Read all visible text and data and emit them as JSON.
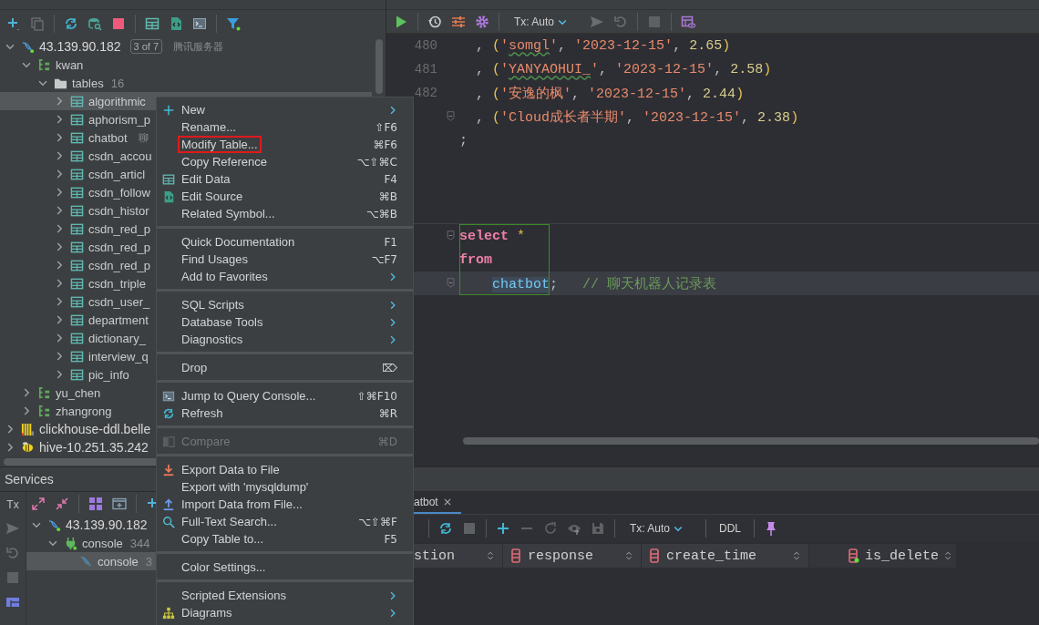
{
  "database_tree": [
    {
      "label": "43.139.90.182",
      "kind": "host",
      "badge": "3 of 7",
      "note": "腾讯服务器",
      "expanded": true,
      "selected": false,
      "children": [
        {
          "label": "kwan",
          "kind": "schema",
          "expanded": true,
          "selected": false,
          "children": [
            {
              "label": "tables",
              "kind": "folder",
              "count": "16",
              "expanded": true,
              "selected": false,
              "children": [
                {
                  "label": "algorithmic",
                  "kind": "table",
                  "expanded": false,
                  "selected": true
                },
                {
                  "label": "aphorism_p",
                  "kind": "table",
                  "expanded": false,
                  "selected": false
                },
                {
                  "label": "chatbot",
                  "kind": "table",
                  "note": "聊",
                  "expanded": false,
                  "selected": false
                },
                {
                  "label": "csdn_accou",
                  "kind": "table",
                  "expanded": false,
                  "selected": false
                },
                {
                  "label": "csdn_articl",
                  "kind": "table",
                  "expanded": false,
                  "selected": false
                },
                {
                  "label": "csdn_follow",
                  "kind": "table",
                  "expanded": false,
                  "selected": false
                },
                {
                  "label": "csdn_histor",
                  "kind": "table",
                  "expanded": false,
                  "selected": false
                },
                {
                  "label": "csdn_red_p",
                  "kind": "table",
                  "expanded": false,
                  "selected": false
                },
                {
                  "label": "csdn_red_p",
                  "kind": "table",
                  "expanded": false,
                  "selected": false
                },
                {
                  "label": "csdn_red_p",
                  "kind": "table",
                  "expanded": false,
                  "selected": false
                },
                {
                  "label": "csdn_triple",
                  "kind": "table",
                  "expanded": false,
                  "selected": false
                },
                {
                  "label": "csdn_user_",
                  "kind": "table",
                  "expanded": false,
                  "selected": false
                },
                {
                  "label": "department",
                  "kind": "table",
                  "expanded": false,
                  "selected": false
                },
                {
                  "label": "dictionary_",
                  "kind": "table",
                  "expanded": false,
                  "selected": false
                },
                {
                  "label": "interview_q",
                  "kind": "table",
                  "expanded": false,
                  "selected": false
                },
                {
                  "label": "pic_info",
                  "kind": "table",
                  "expanded": false,
                  "selected": false
                }
              ]
            }
          ]
        },
        {
          "label": "yu_chen",
          "kind": "schema",
          "expanded": false,
          "selected": false
        },
        {
          "label": "zhangrong",
          "kind": "schema",
          "expanded": false,
          "selected": false
        }
      ]
    },
    {
      "label": "clickhouse-ddl.belle",
      "kind": "bars",
      "expanded": false,
      "selected": false
    },
    {
      "label": "hive-10.251.35.242",
      "kind": "bee",
      "expanded": false,
      "selected": false
    }
  ],
  "editor": {
    "toolbar": {
      "tx": "Tx: Auto"
    },
    "lines": [
      {
        "number": "480",
        "current": false,
        "fold": false,
        "framed": false,
        "tokens": [
          {
            "text": "  , ",
            "kind": "plain"
          },
          {
            "text": "(",
            "kind": "paren"
          },
          {
            "text": "'",
            "kind": "string"
          },
          {
            "text": "somgl",
            "kind": "flagged"
          },
          {
            "text": "'",
            "kind": "string"
          },
          {
            "text": ", ",
            "kind": "plain"
          },
          {
            "text": "'2023-12-15'",
            "kind": "string"
          },
          {
            "text": ", ",
            "kind": "plain"
          },
          {
            "text": "2.65",
            "kind": "number"
          },
          {
            "text": ")",
            "kind": "paren"
          }
        ]
      },
      {
        "number": "481",
        "current": false,
        "fold": false,
        "framed": false,
        "tokens": [
          {
            "text": "  , ",
            "kind": "plain"
          },
          {
            "text": "(",
            "kind": "paren"
          },
          {
            "text": "'",
            "kind": "string"
          },
          {
            "text": "YANYAOHUI_",
            "kind": "flagged"
          },
          {
            "text": "'",
            "kind": "string"
          },
          {
            "text": ", ",
            "kind": "plain"
          },
          {
            "text": "'2023-12-15'",
            "kind": "string"
          },
          {
            "text": ", ",
            "kind": "plain"
          },
          {
            "text": "2.58",
            "kind": "number"
          },
          {
            "text": ")",
            "kind": "paren"
          }
        ]
      },
      {
        "number": "482",
        "current": false,
        "fold": false,
        "framed": false,
        "tokens": [
          {
            "text": "  , ",
            "kind": "plain"
          },
          {
            "text": "(",
            "kind": "paren"
          },
          {
            "text": "'安逸的枫'",
            "kind": "string"
          },
          {
            "text": ", ",
            "kind": "plain"
          },
          {
            "text": "'2023-12-15'",
            "kind": "string"
          },
          {
            "text": ", ",
            "kind": "plain"
          },
          {
            "text": "2.44",
            "kind": "number"
          },
          {
            "text": ")",
            "kind": "paren"
          }
        ]
      },
      {
        "current": false,
        "fold": true,
        "framed": false,
        "tokens": [
          {
            "text": "  , ",
            "kind": "plain"
          },
          {
            "text": "(",
            "kind": "paren"
          },
          {
            "text": "'Cloud成长者半期'",
            "kind": "string"
          },
          {
            "text": ", ",
            "kind": "plain"
          },
          {
            "text": "'2023-12-15'",
            "kind": "string"
          },
          {
            "text": ", ",
            "kind": "plain"
          },
          {
            "text": "2.38",
            "kind": "number"
          },
          {
            "text": ")",
            "kind": "paren"
          }
        ]
      },
      {
        "current": false,
        "fold": false,
        "framed": false,
        "tokens": [
          {
            "text": ";",
            "kind": "plain"
          }
        ]
      },
      {
        "current": false,
        "fold": false,
        "framed": false
      },
      {
        "current": false,
        "fold": false,
        "framed": false
      },
      {
        "current": false,
        "fold": false,
        "framed": false
      },
      {
        "current": false,
        "fold": true,
        "framed": true,
        "tokens": [
          {
            "text": "select",
            "kind": "keyword"
          },
          {
            "text": " *",
            "kind": "operator"
          }
        ]
      },
      {
        "current": false,
        "fold": false,
        "framed": true,
        "tokens": [
          {
            "text": "from",
            "kind": "keyword"
          }
        ]
      },
      {
        "current": true,
        "fold": true,
        "framed": true,
        "tokens": [
          {
            "text": "chatbot",
            "kind": "ident"
          },
          {
            "text": ";",
            "kind": "plain"
          },
          {
            "text": "   // 聊天机器人记录表",
            "kind": "comment"
          }
        ]
      }
    ]
  },
  "services": {
    "title": "Services",
    "side_label": "Tx",
    "tree": [
      {
        "label": "43.139.90.182",
        "kind": "host",
        "expanded": true,
        "selected": false,
        "children": [
          {
            "label": "console",
            "kind": "session",
            "count": "344",
            "expanded": true,
            "selected": false,
            "children": [
              {
                "label": "console",
                "kind": "console",
                "count": "3",
                "selected": true
              }
            ]
          }
        ]
      }
    ]
  },
  "results": {
    "tab": "atbot",
    "toolbar": {
      "tx": "Tx: Auto",
      "ddl": "DDL"
    },
    "columns": [
      {
        "name": "stion",
        "kind": "cut"
      },
      {
        "name": "response",
        "kind": "column"
      },
      {
        "name": "create_time",
        "kind": "column"
      },
      {
        "name": "is_delete",
        "kind": "flagged"
      }
    ]
  },
  "context_menu": {
    "groups": [
      {
        "items": [
          {
            "label": "New",
            "kind": "plus",
            "submenu": true,
            "disabled": false,
            "annotated": false
          },
          {
            "label": "Rename...",
            "shortcut": "⇧F6",
            "kind": "plain",
            "submenu": false,
            "disabled": false,
            "annotated": false
          },
          {
            "label": "Modify Table...",
            "shortcut": "⌘F6",
            "kind": "plain",
            "submenu": false,
            "disabled": false,
            "annotated": true
          },
          {
            "label": "Copy Reference",
            "shortcut": "⌥⇧⌘C",
            "kind": "plain",
            "submenu": false,
            "disabled": false,
            "annotated": false
          },
          {
            "label": "Edit Data",
            "shortcut": "F4",
            "kind": "table",
            "submenu": false,
            "disabled": false,
            "annotated": false
          },
          {
            "label": "Edit Source",
            "shortcut": "⌘B",
            "kind": "source",
            "submenu": false,
            "disabled": false,
            "annotated": false
          },
          {
            "label": "Related Symbol...",
            "shortcut": "⌥⌘B",
            "kind": "plain",
            "submenu": false,
            "disabled": false,
            "annotated": false
          }
        ]
      },
      {
        "items": [
          {
            "label": "Quick Documentation",
            "shortcut": "F1",
            "kind": "plain",
            "submenu": false,
            "disabled": false,
            "annotated": false
          },
          {
            "label": "Find Usages",
            "shortcut": "⌥F7",
            "kind": "plain",
            "submenu": false,
            "disabled": false,
            "annotated": false
          },
          {
            "label": "Add to Favorites",
            "kind": "plain",
            "submenu": true,
            "disabled": false,
            "annotated": false
          }
        ]
      },
      {
        "items": [
          {
            "label": "SQL Scripts",
            "kind": "plain",
            "submenu": true,
            "disabled": false,
            "annotated": false
          },
          {
            "label": "Database Tools",
            "kind": "plain",
            "submenu": true,
            "disabled": false,
            "annotated": false
          },
          {
            "label": "Diagnostics",
            "kind": "plain",
            "submenu": true,
            "disabled": false,
            "annotated": false
          }
        ]
      },
      {
        "items": [
          {
            "label": "Drop",
            "shortcut": "⌦",
            "kind": "plain",
            "submenu": false,
            "disabled": false,
            "annotated": false
          }
        ]
      },
      {
        "items": [
          {
            "label": "Jump to Query Console...",
            "shortcut": "⇧⌘F10",
            "kind": "console",
            "submenu": false,
            "disabled": false,
            "annotated": false
          },
          {
            "label": "Refresh",
            "shortcut": "⌘R",
            "kind": "refresh",
            "submenu": false,
            "disabled": false,
            "annotated": false
          }
        ]
      },
      {
        "items": [
          {
            "label": "Compare",
            "shortcut": "⌘D",
            "kind": "compare",
            "submenu": false,
            "disabled": true,
            "annotated": false
          }
        ]
      },
      {
        "items": [
          {
            "label": "Export Data to File",
            "kind": "export",
            "submenu": false,
            "disabled": false,
            "annotated": false
          },
          {
            "label": "Export with 'mysqldump'",
            "kind": "plain",
            "submenu": false,
            "disabled": false,
            "annotated": false
          },
          {
            "label": "Import Data from File...",
            "kind": "import",
            "submenu": false,
            "disabled": false,
            "annotated": false
          },
          {
            "label": "Full-Text Search...",
            "shortcut": "⌥⇧⌘F",
            "kind": "search",
            "submenu": false,
            "disabled": false,
            "annotated": false
          },
          {
            "label": "Copy Table to...",
            "shortcut": "F5",
            "kind": "plain",
            "submenu": false,
            "disabled": false,
            "annotated": false
          }
        ]
      },
      {
        "items": [
          {
            "label": "Color Settings...",
            "kind": "plain",
            "submenu": false,
            "disabled": false,
            "annotated": false
          }
        ]
      },
      {
        "items": [
          {
            "label": "Scripted Extensions",
            "kind": "plain",
            "submenu": true,
            "disabled": false,
            "annotated": false
          },
          {
            "label": "Diagrams",
            "kind": "diagram",
            "submenu": true,
            "disabled": false,
            "annotated": false
          }
        ]
      }
    ]
  }
}
